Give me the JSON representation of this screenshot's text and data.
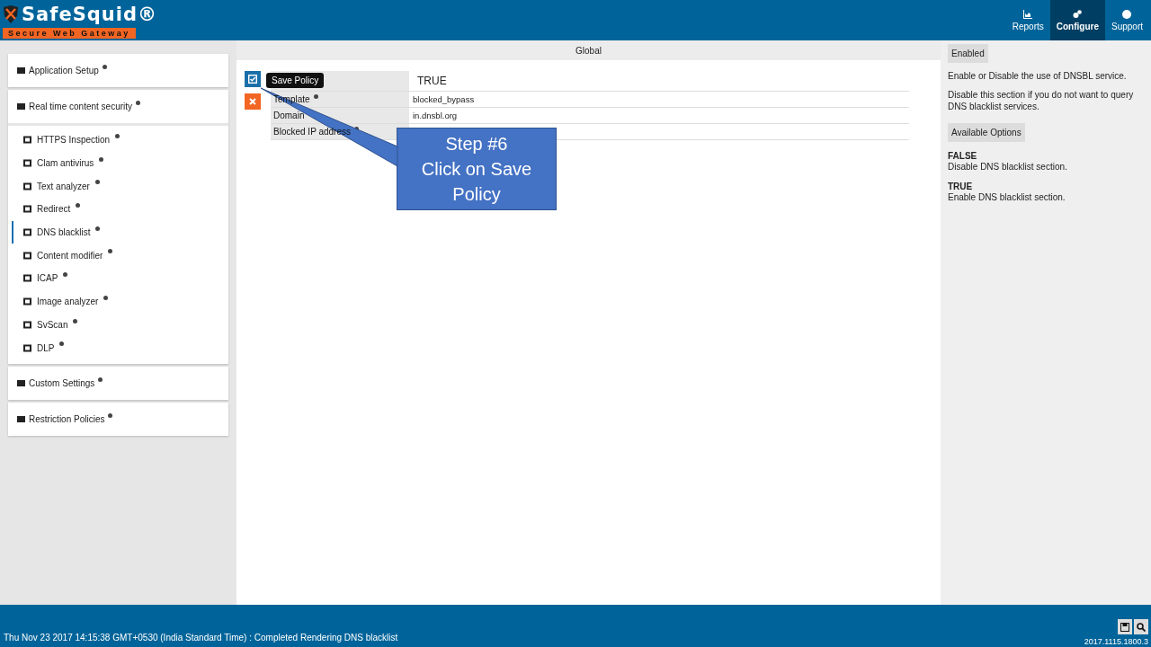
{
  "header": {
    "logo": "SafeSquid®",
    "tagline": "Secure Web Gateway",
    "nav": [
      {
        "label": "Reports",
        "selected": false
      },
      {
        "label": "Configure",
        "selected": true
      },
      {
        "label": "Support",
        "selected": false
      }
    ]
  },
  "sidebar": {
    "sections": [
      {
        "label": "Application Setup"
      },
      {
        "label": "Real time content security",
        "items": [
          {
            "label": "HTTPS Inspection",
            "selected": false
          },
          {
            "label": "Clam antivirus",
            "selected": false
          },
          {
            "label": "Text analyzer",
            "selected": false
          },
          {
            "label": "Redirect",
            "selected": false
          },
          {
            "label": "DNS blacklist",
            "selected": true
          },
          {
            "label": "Content modifier",
            "selected": false
          },
          {
            "label": "ICAP",
            "selected": false
          },
          {
            "label": "Image analyzer",
            "selected": false
          },
          {
            "label": "SvScan",
            "selected": false
          },
          {
            "label": "DLP",
            "selected": false
          }
        ]
      },
      {
        "label": "Custom Settings"
      },
      {
        "label": "Restriction Policies"
      }
    ]
  },
  "breadcrumb": "Global",
  "tooltip": "Save Policy",
  "form": {
    "rows": [
      {
        "label": "",
        "value": "TRUE"
      },
      {
        "label": "Template",
        "value": "blocked_bypass"
      },
      {
        "label": "Domain",
        "value": "in.dnsbl.org"
      },
      {
        "label": "Blocked IP address",
        "value": ""
      }
    ]
  },
  "callout": "Step #6\nClick on Save Policy",
  "help": {
    "title": "Enabled",
    "paragraphs": [
      "Enable or Disable the use of DNSBL service.",
      "Disable this section if you do not want to query DNS blacklist services."
    ],
    "options_title": "Available Options",
    "options": [
      {
        "name": "FALSE",
        "description": "Disable DNS blacklist section."
      },
      {
        "name": "TRUE",
        "description": "Enable DNS blacklist section."
      }
    ]
  },
  "status_bar": {
    "message": "Thu Nov 23 2017 14:15:38 GMT+0530 (India Standard Time) : Completed Rendering DNS blacklist",
    "version": "2017.1115.1800.3"
  }
}
